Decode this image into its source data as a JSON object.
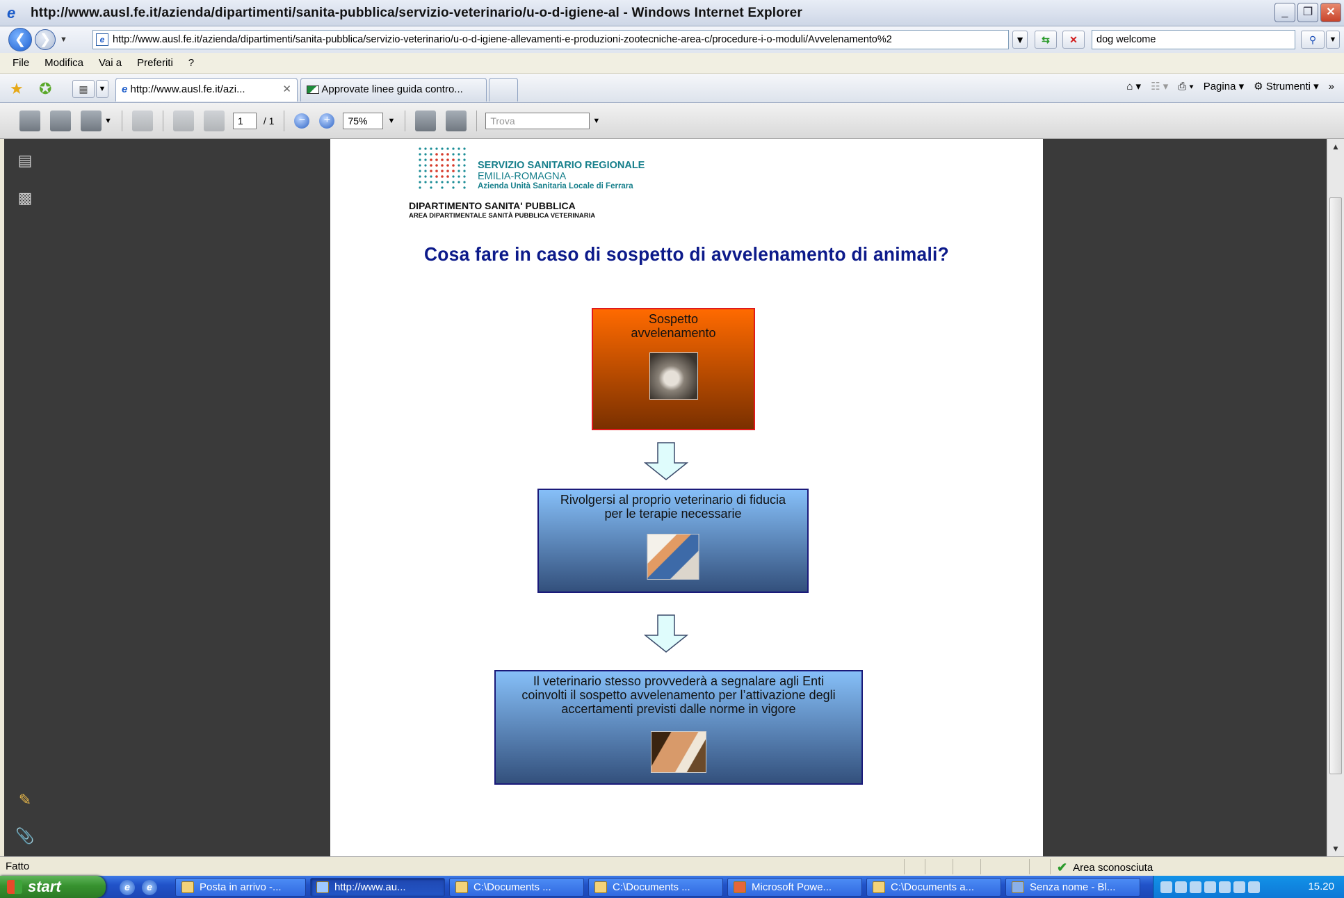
{
  "window": {
    "title": "http://www.ausl.fe.it/azienda/dipartimenti/sanita-pubblica/servizio-veterinario/u-o-d-igiene-al - Windows Internet Explorer",
    "controls": [
      "_",
      "❐",
      "✕"
    ]
  },
  "address_bar": {
    "url": "http://www.ausl.fe.it/azienda/dipartimenti/sanita-pubblica/servizio-veterinario/u-o-d-igiene-allevamenti-e-produzioni-zootecniche-area-c/procedure-i-o-moduli/Avvelenamento%2",
    "search_value": "dog welcome"
  },
  "menu": [
    "File",
    "Modifica",
    "Vai a",
    "Preferiti",
    "?"
  ],
  "tabs": [
    {
      "label": "http://www.ausl.fe.it/azi...",
      "active": true
    },
    {
      "label": "Approvate linee guida contro...",
      "active": false
    }
  ],
  "tab_tools": {
    "page": "Pagina",
    "tools": "Strumenti"
  },
  "pdf_toolbar": {
    "page_current": "1",
    "page_total": "/ 1",
    "zoom": "75%",
    "find_placeholder": "Trova"
  },
  "document": {
    "org_line1": "SERVIZIO SANITARIO REGIONALE",
    "org_line2": "EMILIA-ROMAGNA",
    "org_line3": "Azienda Unità Sanitaria Locale di Ferrara",
    "dept_line1": "DIPARTIMENTO SANITA' PUBBLICA",
    "dept_line2": "AREA DIPARTIMENTALE SANITÀ PUBBLICA VETERINARIA",
    "heading": "Cosa fare in caso di sospetto di avvelenamento di animali?",
    "steps": [
      {
        "text": "Sospetto avvelenamento"
      },
      {
        "text": "Rivolgersi al proprio veterinario di fiducia per le terapie necessarie"
      },
      {
        "text": "Il veterinario stesso provvederà a segnalare agli Enti coinvolti il sospetto avvelenamento per l’attivazione degli accertamenti previsti dalle norme in vigore"
      }
    ],
    "colors": {
      "step1": "#ff6a00",
      "step_blue": "#86bff8",
      "heading": "#0c1a8a"
    }
  },
  "status": {
    "text": "Fatto",
    "zone": "Area sconosciuta"
  },
  "taskbar": {
    "start": "start",
    "items": [
      "Posta in arrivo -...",
      "http://www.au...",
      "C:\\Documents ...",
      "C:\\Documents ...",
      "Microsoft Powe...",
      "C:\\Documents a...",
      "Senza nome - Bl..."
    ],
    "clock": "15.20"
  }
}
